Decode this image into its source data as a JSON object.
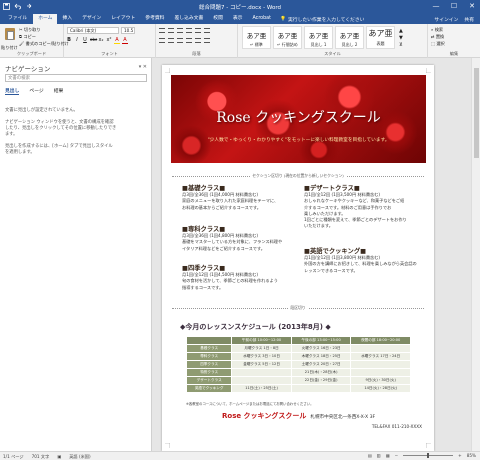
{
  "window": {
    "title": "総合問題7 - コピー.docx - Word",
    "controls": [
      "—",
      "☐",
      "✕"
    ]
  },
  "tabs": {
    "file": "ファイル",
    "items": [
      "ホーム",
      "挿入",
      "デザイン",
      "レイアウト",
      "参考資料",
      "差し込み文書",
      "校閲",
      "表示",
      "Acrobat"
    ],
    "tell_me": "実行したい作業を入力してください",
    "sign_in": "サインイン",
    "share": "共有"
  },
  "ribbon": {
    "clipboard": {
      "paste": "貼り付け",
      "cut": "切り取り",
      "copy": "コピー",
      "painter": "書式のコピー/貼り付け",
      "label": "クリップボード"
    },
    "font": {
      "name": "Calibri (本文)",
      "size": "10.5",
      "label": "フォント",
      "buttons": [
        "B",
        "I",
        "U",
        "abc",
        "x₂",
        "x²",
        "A",
        "A"
      ]
    },
    "paragraph": {
      "label": "段落"
    },
    "styles": {
      "label": "スタイル",
      "items": [
        {
          "sample": "あア亜",
          "name": "↵ 標準"
        },
        {
          "sample": "あア亜",
          "name": "↵ 行間詰め"
        },
        {
          "sample": "あア亜",
          "name": "見出し 1"
        },
        {
          "sample": "あア亜",
          "name": "見出し 2"
        },
        {
          "sample": "あア亜",
          "name": "表題"
        }
      ]
    },
    "editing": {
      "find": "検索",
      "replace": "置換",
      "select": "選択",
      "label": "編集"
    }
  },
  "nav": {
    "title": "ナビゲーション",
    "search_placeholder": "文書の検索",
    "tabs": [
      "見出し",
      "ページ",
      "結果"
    ],
    "message": [
      "文書に見出しが設定されていません。",
      "ナビゲーション ウィンドウを使うと、文書の構成を確認",
      "したり、見出しをクリックしてその位置に移動したりでき",
      "ます。",
      "見出しを作成するには、[ホーム] タブで見出しスタイル",
      "を適用します。"
    ]
  },
  "document": {
    "banner_title": "Rose クッキングスクール",
    "banner_sub": "\"少人数で・ゆっくり・わかりやすく\"をモットーに楽しい料理教室を目指しています。",
    "section_break_1": "セクション区切り (現在の位置から新しいセクション)",
    "section_break_2": "段区切り",
    "left": [
      {
        "heading": "■基礎クラス■",
        "lines": [
          "月3回/全36回 (1回4,000円 材料費含む)",
          "家庭のメニューを取り入れた家庭料理をテーマに、",
          "お料理の基本からご紹介するコースです。"
        ]
      },
      {
        "heading": "■専科クラス■",
        "lines": [
          "月3回/全36回 (1回4,800円 材料費含む)",
          "基礎をマスターしている方を対象に、フランス料理や",
          "イタリア料理などをご紹介するコースです。"
        ]
      },
      {
        "heading": "■四季クラス■",
        "lines": [
          "月1回/全12回 (1回4,500円 材料費含む)",
          "旬の食材を活かして、季節ごとの料理を作れるよう",
          "指導するコースです。"
        ]
      }
    ],
    "right": [
      {
        "heading": "■デザートクラス■",
        "lines": [
          "月1回/全12回 (1回3,500円 材料費含む)",
          "おしゃれなケーキやクッキーなど、和菓子などをご紹",
          "介するコースです。材料のご用意は手作りでお",
          "楽しみいただけます。",
          "1回ごとに種類を変えて、季節ごとのデザートをお作り",
          "いただけます。"
        ]
      },
      {
        "heading": "■英語でクッキング■",
        "lines": [
          "月1回/全12回 (1回3,800円 材料費含む)",
          "外国の方を講師にお招きして、料理を楽しみながら英会話の",
          "レッスンできるコースです。"
        ]
      }
    ],
    "schedule_title": "◆今月のレッスンスケジュール (2013年8月) ◆",
    "table": {
      "headers": [
        "",
        "午前の部 10:00~12:00",
        "午後の部 13:00~15:00",
        "夜間の部 18:00~20:00"
      ],
      "rows": [
        [
          "基礎クラス",
          "月曜クラス 1日・8日",
          "火曜クラス 16日・23日",
          ""
        ],
        [
          "専科クラス",
          "水曜クラス 3日・10日",
          "木曜クラス 18日・25日",
          "水曜クラス 17日・24日"
        ],
        [
          "四季クラス",
          "金曜クラス 5日・12日",
          "土曜クラス 20日・27日",
          ""
        ],
        [
          "特別クラス",
          "",
          "21日(木)・28日(木)",
          ""
        ],
        [
          "デザートクラス",
          "",
          "22日(金)・29日(金)",
          "9日(火)・30日(火)"
        ],
        [
          "英語でクッキング",
          "11日(土)・25日(土)",
          "",
          "14日(火)・28日(火)"
        ]
      ]
    },
    "table_note": "※各教室のコースについて、ホームページまたはお電話にてお問い合わせください。",
    "footer_brand": "Rose クッキングスクール",
    "footer_addr": "札幌市中央区北一条西X-X-X 3F",
    "tel": "TEL&FAX 011-210-XXXX"
  },
  "status": {
    "page": "1/1 ページ",
    "words": "701 文字",
    "lang": "英語 (米国)",
    "zoom": "85%"
  }
}
